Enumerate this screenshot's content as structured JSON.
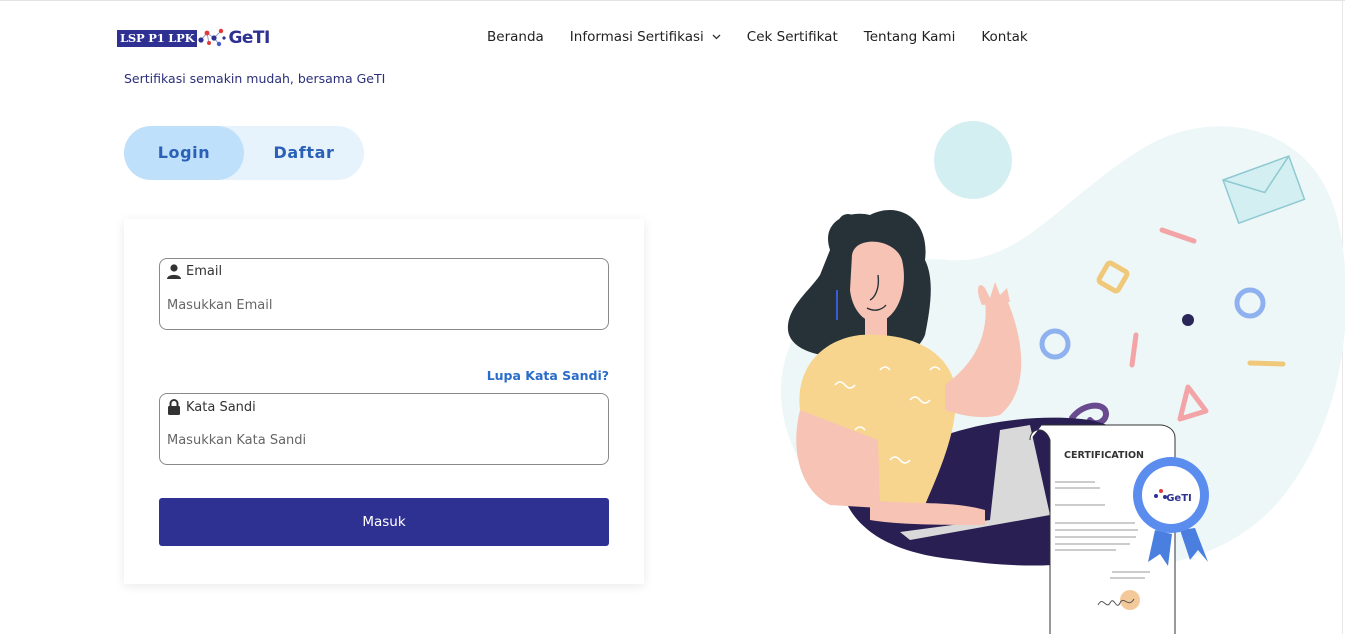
{
  "brand": {
    "lsp_text": "LSP P1 LPK",
    "geti_text": "GeTI",
    "tagline": "Sertifikasi semakin mudah, bersama GeTI"
  },
  "nav": {
    "items": [
      {
        "label": "Beranda"
      },
      {
        "label": "Informasi Sertifikasi",
        "has_dropdown": true
      },
      {
        "label": "Cek Sertifikat"
      },
      {
        "label": "Tentang Kami"
      },
      {
        "label": "Kontak"
      }
    ]
  },
  "auth_tabs": {
    "login": "Login",
    "register": "Daftar",
    "active": "login"
  },
  "form": {
    "email_label": "Email",
    "email_placeholder": "Masukkan Email",
    "password_label": "Kata Sandi",
    "password_placeholder": "Masukkan Kata Sandi",
    "forgot_password": "Lupa Kata Sandi?",
    "submit_label": "Masuk"
  },
  "illustration": {
    "certificate_title": "CERTIFICATION",
    "badge_text": "GeTI"
  },
  "colors": {
    "primary": "#2e3192",
    "tab_active": "#bfe0fa",
    "tab_bg": "#e6f2fc",
    "link": "#2a6cc9"
  },
  "icons": [
    "user-icon",
    "lock-icon",
    "chevron-down-icon"
  ]
}
